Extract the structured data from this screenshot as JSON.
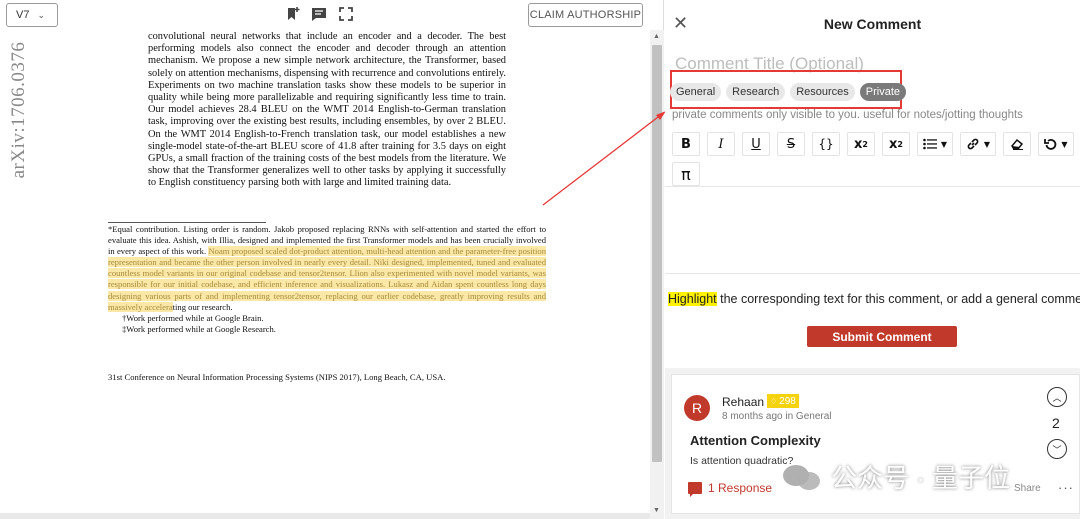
{
  "viewer": {
    "version": "V7",
    "claim_label": "CLAIM AUTHORSHIP",
    "arxiv_id": "arXiv:1706.0376",
    "icons": [
      "bookmark-add-icon",
      "comment-icon",
      "fullscreen-icon"
    ],
    "abstract": "convolutional neural networks that include an encoder and a decoder. The best performing models also connect the encoder and decoder through an attention mechanism. We propose a new simple network architecture, the Transformer, based solely on attention mechanisms, dispensing with recurrence and convolutions entirely. Experiments on two machine translation tasks show these models to be superior in quality while being more parallelizable and requiring significantly less time to train. Our model achieves 28.4 BLEU on the WMT 2014 English-to-German translation task, improving over the existing best results, including ensembles, by over 2 BLEU. On the WMT 2014 English-to-French translation task, our model establishes a new single-model state-of-the-art BLEU score of 41.8 after training for 3.5 days on eight GPUs, a small fraction of the training costs of the best models from the literature. We show that the Transformer generalizes well to other tasks by applying it successfully to English constituency parsing both with large and limited training data.",
    "footnote_plain": "*Equal contribution. Listing order is random. Jakob proposed replacing RNNs with self-attention and started the effort to evaluate this idea. Ashish, with Illia, designed and implemented the first Transformer models and has been crucially involved in every aspect of this work.",
    "footnote_highlight": "Noam proposed scaled dot-product attention, multi-head attention and the parameter-free position representation and became the other person involved in nearly every detail. Niki designed, implemented, tuned and evaluated countless model variants in our original codebase and tensor2tensor. Llion also experimented with novel model variants, was responsible for our initial codebase, and efficient inference and visualizations. Lukasz and Aidan spent countless long days designing various parts of and implementing tensor2tensor, replacing our earlier codebase, greatly improving results and massively accelera",
    "footnote_tail": "ting our research.",
    "footnote_brain": "†Work performed while at Google Brain.",
    "footnote_research": "‡Work performed while at Google Research.",
    "conference": "31st Conference on Neural Information Processing Systems (NIPS 2017), Long Beach, CA, USA."
  },
  "panel": {
    "title": "New Comment",
    "title_placeholder": "Comment Title (Optional)",
    "tags": [
      "General",
      "Research",
      "Resources",
      "Private"
    ],
    "active_tag": "Private",
    "tag_hint": "private comments only visible to you. useful for notes/jotting thoughts",
    "hint_highlight": "Highlight",
    "hint_rest": " the corresponding text for this comment, or add a general comment",
    "submit_label": "Submit Comment",
    "colors": {
      "accent": "#c0392b",
      "annotation": "#e53935",
      "highlight": "#fff200"
    }
  },
  "comment": {
    "avatar_letter": "R",
    "author": "Rehaan",
    "reputation": "298",
    "meta": "8 months ago in General",
    "title": "Attention Complexity",
    "body": "Is attention quadratic?",
    "votes": "2",
    "responses": "1 Response",
    "share": "Share"
  },
  "watermark": {
    "text": "公众号 · 量子位"
  }
}
